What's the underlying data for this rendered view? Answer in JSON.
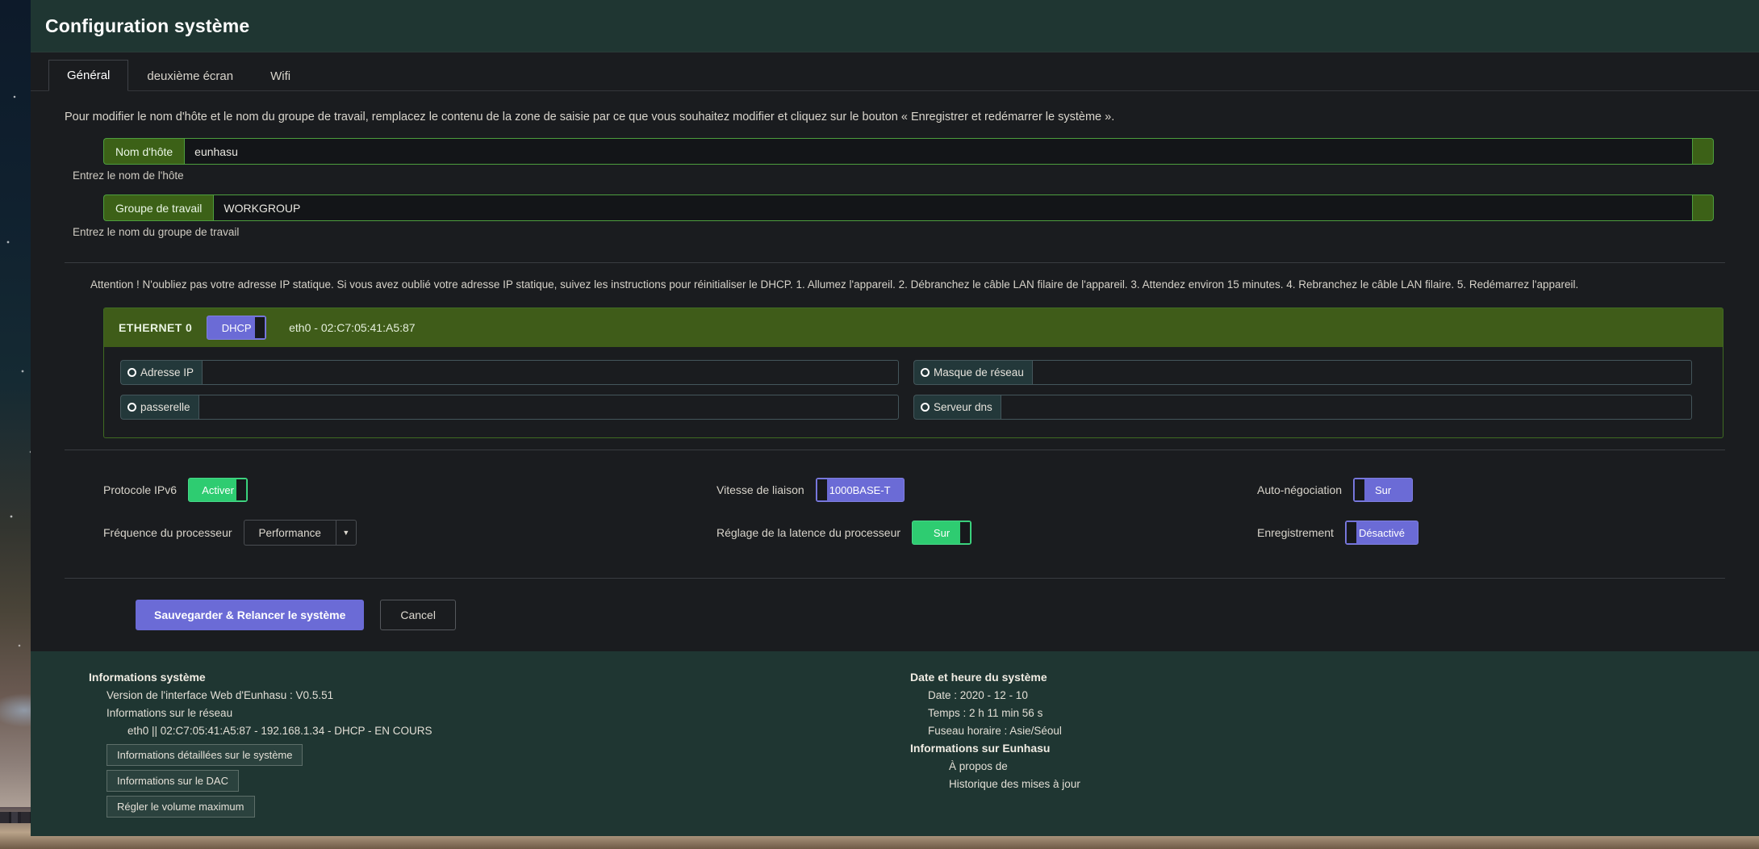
{
  "header": {
    "title": "Configuration système"
  },
  "tabs": [
    {
      "label": "Général",
      "active": true
    },
    {
      "label": "deuxième écran",
      "active": false
    },
    {
      "label": "Wifi",
      "active": false
    }
  ],
  "main": {
    "help_text": "Pour modifier le nom d'hôte et le nom du groupe de travail, remplacez le contenu de la zone de saisie par ce que vous souhaitez modifier et cliquez sur le bouton « Enregistrer et redémarrer le système ».",
    "hostname": {
      "label": "Nom d'hôte",
      "value": "eunhasu",
      "hint": "Entrez le nom de l'hôte"
    },
    "workgroup": {
      "label": "Groupe de travail",
      "value": "WORKGROUP",
      "hint": "Entrez le nom du groupe de travail"
    },
    "warning": "Attention ! N'oubliez pas votre adresse IP statique. Si vous avez oublié votre adresse IP statique, suivez les instructions pour réinitialiser le DHCP. 1. Allumez l'appareil. 2. Débranchez le câble LAN filaire de l'appareil. 3. Attendez environ 15 minutes. 4. Rebranchez le câble LAN filaire. 5. Redémarrez l'appareil."
  },
  "ethernet": {
    "title": "ETHERNET 0",
    "dhcp_toggle": {
      "label": "DHCP",
      "state": "on",
      "knob": "right",
      "color": "#6b6bd6"
    },
    "interface_info": "eth0  -  02:C7:05:41:A5:87",
    "fields": [
      {
        "label": "Adresse IP",
        "value": "",
        "icon": "radio-circle-icon"
      },
      {
        "label": "Masque de réseau",
        "value": "",
        "icon": "radio-circle-icon"
      },
      {
        "label": "passerelle",
        "value": "",
        "icon": "radio-circle-icon"
      },
      {
        "label": "Serveur dns",
        "value": "",
        "icon": "radio-circle-icon"
      }
    ]
  },
  "settings": {
    "ipv6": {
      "label": "Protocole IPv6",
      "value": "Activer",
      "knob": "right",
      "color": "#2ecc71"
    },
    "link_speed": {
      "label": "Vitesse de liaison",
      "value": "1000BASE-T",
      "knob": "left",
      "color": "#6b6bd6"
    },
    "autoneg": {
      "label": "Auto-négociation",
      "value": "Sur",
      "knob": "left",
      "color": "#6b6bd6"
    },
    "cpu_freq": {
      "label": "Fréquence du processeur",
      "value": "Performance",
      "options": [
        "Performance"
      ]
    },
    "cpu_latency": {
      "label": "Réglage de la latence du processeur",
      "value": "Sur",
      "knob": "right",
      "color": "#2ecc71"
    },
    "logging": {
      "label": "Enregistrement",
      "value": "Désactivé",
      "knob": "left",
      "color": "#6b6bd6"
    }
  },
  "actions": {
    "save_label": "Sauvegarder & Relancer le système",
    "cancel_label": "Cancel"
  },
  "footer": {
    "system_info": {
      "heading": "Informations système",
      "web_version": "Version de l'interface Web d'Eunhasu : V0.5.51",
      "network_heading": "Informations sur le réseau",
      "network_detail": "eth0 || 02:C7:05:41:A5:87 - 192.168.1.34 - DHCP - EN COURS",
      "buttons": [
        "Informations détaillées sur le système",
        "Informations sur le DAC",
        "Régler le volume maximum"
      ]
    },
    "datetime": {
      "heading": "Date et heure du système",
      "date": "Date : 2020 - 12 - 10",
      "time": "Temps :  2 h 11 min 56 s",
      "timezone": "Fuseau horaire : Asie/Séoul"
    },
    "eunhasu": {
      "heading": "Informations sur Eunhasu",
      "links": [
        "À propos de",
        "Historique des mises à jour"
      ]
    }
  }
}
